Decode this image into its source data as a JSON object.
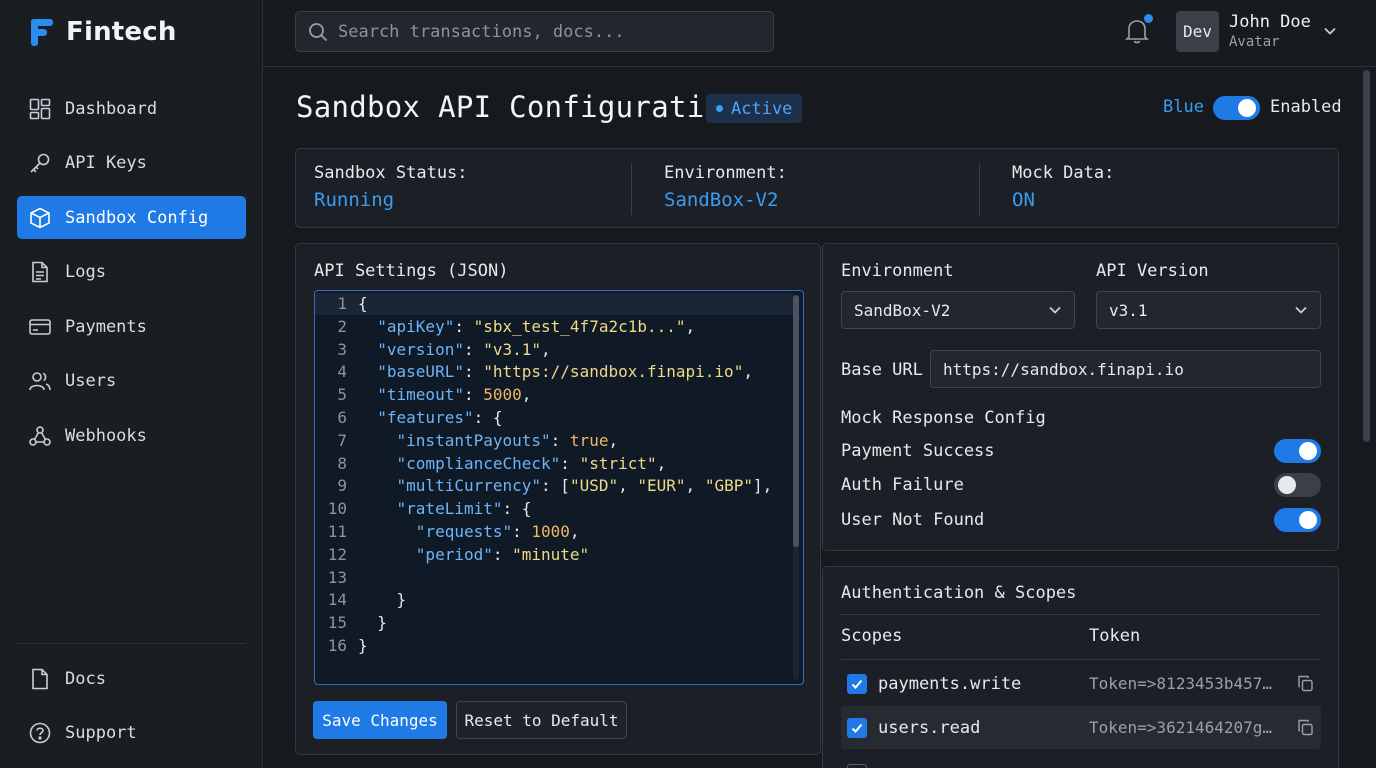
{
  "app": {
    "name": "Fintech"
  },
  "sidebar": {
    "items": [
      {
        "label": "Dashboard",
        "icon": "dashboard-icon"
      },
      {
        "label": "API Keys",
        "icon": "key-icon"
      },
      {
        "label": "Sandbox Config",
        "icon": "cube-icon",
        "active": true
      },
      {
        "label": "Logs",
        "icon": "document-icon"
      },
      {
        "label": "Payments",
        "icon": "credit-card-icon"
      },
      {
        "label": "Users",
        "icon": "users-icon"
      },
      {
        "label": "Webhooks",
        "icon": "webhook-icon"
      }
    ],
    "bottom": [
      {
        "label": "Docs",
        "icon": "file-icon"
      },
      {
        "label": "Support",
        "icon": "help-icon"
      }
    ]
  },
  "topbar": {
    "search_placeholder": "Search transactions, docs...",
    "avatar_text": "Dev",
    "user_name": "John Doe",
    "user_sub": "Avatar"
  },
  "page": {
    "title": "Sandbox API Configuration",
    "badge": "Active",
    "theme_label": "Blue",
    "enabled_label": "Enabled",
    "enabled": true
  },
  "status": {
    "sandbox_label": "Sandbox Status:",
    "sandbox_value": "Running",
    "env_label": "Environment:",
    "env_value": "SandBox-V2",
    "mock_label": "Mock Data:",
    "mock_value": "ON"
  },
  "json_panel": {
    "title": "API Settings (JSON)",
    "line_numbers": [
      "1",
      "2",
      "3",
      "4",
      "5",
      "6",
      "7",
      "8",
      "9",
      "10",
      "11",
      "12",
      "13",
      "14",
      "15",
      "16"
    ],
    "save_label": "Save Changes",
    "reset_label": "Reset to Default"
  },
  "settings": {
    "environment_label": "Environment",
    "environment_value": "SandBox-V2",
    "api_version_label": "API Version",
    "api_version_value": "v3.1",
    "base_url_label": "Base URL",
    "base_url_value": "https://sandbox.finapi.io",
    "mock_title": "Mock Response Config",
    "mocks": [
      {
        "label": "Payment Success",
        "on": true
      },
      {
        "label": "Auth Failure",
        "on": false
      },
      {
        "label": "User Not Found",
        "on": true
      }
    ]
  },
  "auth": {
    "title": "Authentication & Scopes",
    "col_scopes": "Scopes",
    "col_token": "Token",
    "rows": [
      {
        "scope": "payments.write",
        "token": "Token=>8123453b457...",
        "checked": true
      },
      {
        "scope": "users.read",
        "token": "Token=>3621464207g...",
        "checked": true
      }
    ]
  },
  "colors": {
    "accent": "#1f7ae6",
    "background": "#16191e",
    "panel": "#1c1f25"
  }
}
